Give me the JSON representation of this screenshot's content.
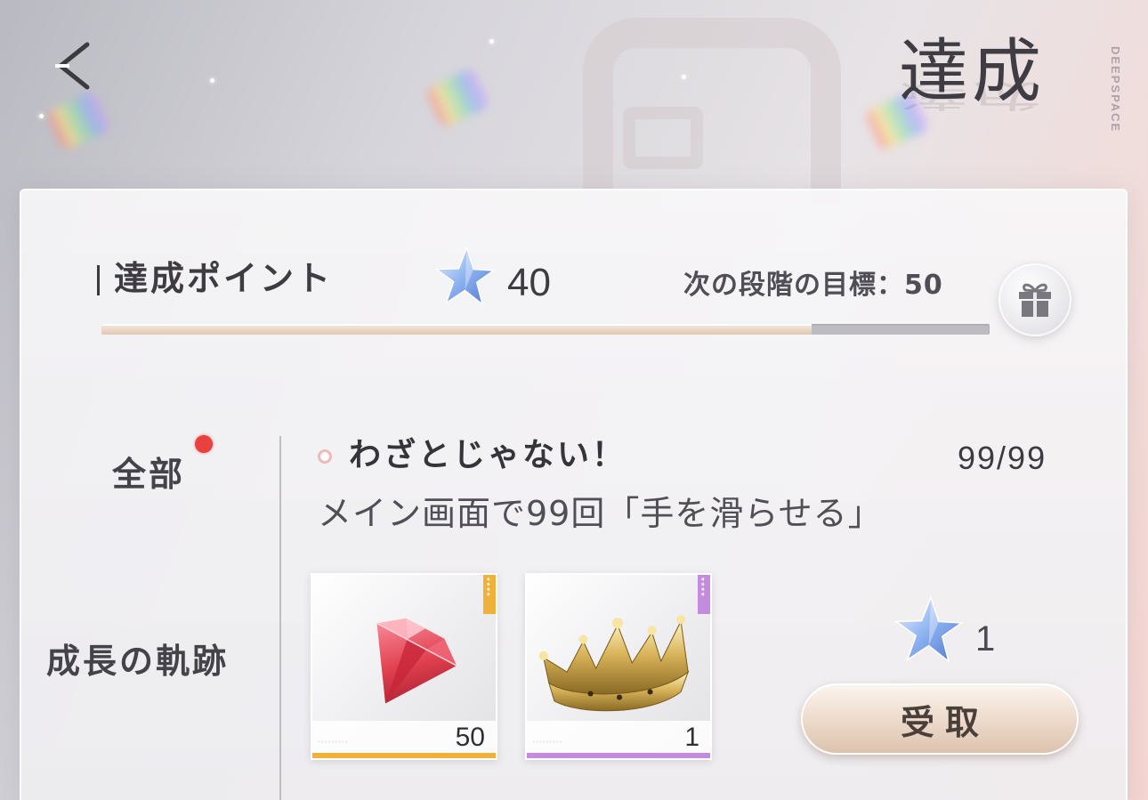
{
  "header": {
    "title": "達成",
    "brand": "DEEPSPACE"
  },
  "points": {
    "label": "達成ポイント",
    "value": "40",
    "next_goal_label": "次の段階の目標：50",
    "progress": 0.8
  },
  "tabs": [
    {
      "label": "全部",
      "active": true,
      "has_notification": true
    },
    {
      "label": "成長の軌跡",
      "active": false,
      "has_notification": false
    }
  ],
  "achievement": {
    "title": "わざとじゃない！",
    "progress": "99/99",
    "description": "メイン画面で99回「手を滑らせる」",
    "rewards": [
      {
        "item": "diamond-gem",
        "quantity": "50",
        "tier_color": "#f0b13a"
      },
      {
        "item": "gold-crown",
        "quantity": "1",
        "tier_color": "#c58bde"
      }
    ],
    "point_reward": "1",
    "claim_label": "受取"
  },
  "colors": {
    "accent_star": "#7fa6ea",
    "notification": "#e9413e",
    "claim_button": "#e6cfbd"
  }
}
